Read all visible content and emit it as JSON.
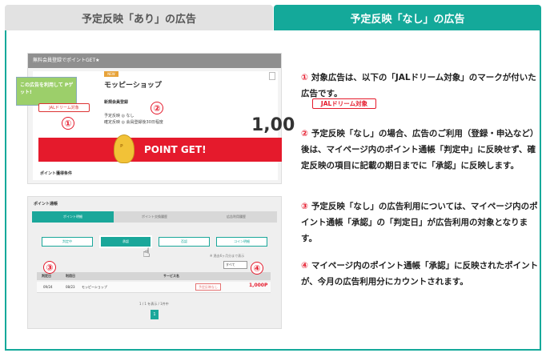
{
  "tabs": {
    "with_provisional": "予定反映「あり」の広告",
    "without_provisional": "予定反映「なし」の広告"
  },
  "screenshot1": {
    "topbar": "無料会員登録でポイントGET★",
    "thumb_text": "この広告を利用して Pゲット!",
    "jal_badge": "JALドリーム対象",
    "new_label": "NEW",
    "shop_name": "モッピーショップ",
    "reg_title": "新規会員登録",
    "reg_line1": "予定反映 ◎ なし",
    "reg_line2": "確定反映 ◎ 会員登録後30日程度",
    "big_number": "1,00",
    "banner_text": "POINT GET!",
    "mascot_text": "P",
    "conditions": "ポイント獲得条件",
    "mark1": "①",
    "mark2": "②"
  },
  "screenshot2": {
    "title": "ポイント通帳",
    "tabs": [
      "ポイント明細",
      "ポイント交換履歴",
      "広告利用履歴"
    ],
    "buttons": [
      "判定中",
      "承認",
      "否認",
      "コイン明細"
    ],
    "filter_note": "※ 過去6ヶ月分まで表示",
    "select_value": "すべて",
    "headers": [
      "判定日",
      "利用日",
      "サービス名"
    ],
    "row": {
      "judge_date": "09/24",
      "use_date": "08/23",
      "service": "モッピーショップ",
      "status": "予定反映なし",
      "points": "1,000P"
    },
    "pager_text": "1 / 1 を表示 / 1件中",
    "pager_page": "1",
    "mark3": "③",
    "mark4": "④"
  },
  "notes": [
    {
      "num": "①",
      "text": "対象広告は、以下の「JALドリーム対象」のマークが付いた広告です。"
    },
    {
      "num": "②",
      "text": "予定反映「なし」の場合、広告のご利用（登録・申込など）後は、マイページ内のポイント通帳「判定中」に反映せず、確定反映の項目に記載の期日までに「承認」に反映します。"
    },
    {
      "num": "③",
      "text": "予定反映「なし」の広告利用については、マイページ内のポイント通帳「承認」の「判定日」が広告利用の対象となります。"
    },
    {
      "num": "④",
      "text": "マイページ内のポイント通帳「承認」に反映されたポイントが、今月の広告利用分にカウントされます。"
    }
  ],
  "jal_badge": "JALドリーム対象",
  "colors": {
    "accent": "#14a99a",
    "red": "#e51a2c"
  }
}
